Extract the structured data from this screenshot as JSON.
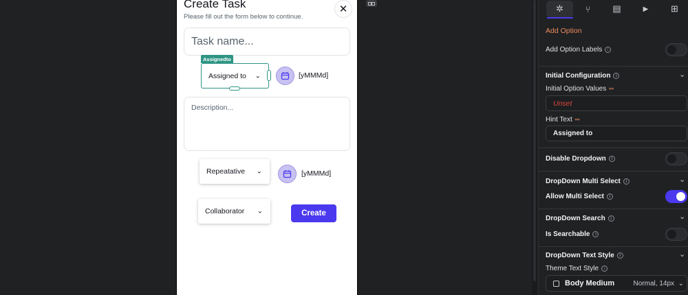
{
  "form": {
    "title": "Create Task",
    "subtitle": "Please fill out the form below to continue.",
    "close_glyph": "✕",
    "task_placeholder": "Task name...",
    "selected_badge": "Assignedto",
    "assigned_dropdown": "Assigned to",
    "date_format_1": "[yMMMd]",
    "description_placeholder": "Description...",
    "repeat_dropdown": "Repeatative",
    "date_format_2": "[yMMMd]",
    "collaborator_dropdown": "Collaborator",
    "create_label": "Create",
    "chevron": "⌄"
  },
  "panel": {
    "tabs": [
      {
        "icon": "widget-tools-icon",
        "glyph": "✲"
      },
      {
        "icon": "actions-flow-icon",
        "glyph": "⑂"
      },
      {
        "icon": "backend-query-icon",
        "glyph": "▤"
      },
      {
        "icon": "play-icon",
        "glyph": "▶"
      },
      {
        "icon": "generate-icon",
        "glyph": "⊞"
      }
    ],
    "add_option": "Add Option",
    "add_option_labels": "Add Option Labels",
    "initial_configuration": "Initial Configuration",
    "initial_option_values": "Initial Option Values",
    "initial_value_placeholder": "Unset",
    "hint_text_label": "Hint Text",
    "hint_text_value": "Assigned to",
    "disable_dropdown": "Disable Dropdown",
    "multi_select_section": "DropDown Multi Select",
    "allow_multi_select": "Allow Multi Select",
    "search_section": "DropDown Search",
    "is_searchable": "Is Searchable",
    "text_style_section": "DropDown Text Style",
    "theme_text_style": "Theme Text Style",
    "style_name": "Body Medium",
    "style_detail": "Normal, 14px"
  },
  "toggles": {
    "add_option_labels": false,
    "disable_dropdown": false,
    "allow_multi_select": true,
    "is_searchable": false
  },
  "colors": {
    "primary": "#4b39ef",
    "accent": "#ee8b60",
    "selection": "#2e9484",
    "unset_red": "#e0483c"
  }
}
